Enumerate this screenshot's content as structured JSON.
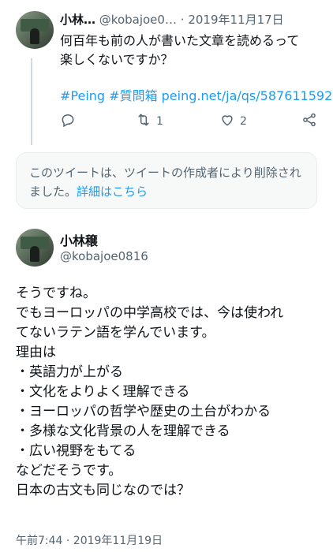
{
  "reply_tweet": {
    "display_name": "小林…",
    "handle": "@kobajoe0…",
    "separator": "·",
    "date": "2019年11月17日",
    "text_lines": [
      "何百年も前の人が書いた文章を読めるって",
      "楽しくないですか？"
    ],
    "hashtags": "#Peing #質問箱 peing.net/ja/qs/587611592",
    "actions": {
      "reply_icon": "reply-icon",
      "retweet_icon": "retweet-icon",
      "retweet_count": "1",
      "like_icon": "heart-icon",
      "like_count": "2",
      "share_icon": "share-icon"
    }
  },
  "deleted_notice": {
    "text": "このツイートは、ツイートの作成者により削除されました。",
    "link": "詳細はこちら"
  },
  "main_tweet": {
    "display_name": "小林穣",
    "handle": "@kobajoe0816",
    "body_lines": [
      "そうですね。",
      "でもヨーロッパの中学高校では、今は使われ",
      "てないラテン語を学んでいます。",
      "理由は",
      "・英語力が上がる",
      "・文化をよりよく理解できる",
      "・ヨーロッパの哲学や歴史の土台がわかる",
      "・多様な文化背景の人を理解できる",
      "・広い視野をもてる",
      "などだそうです。",
      "日本の古文も同じなのでは？"
    ],
    "timestamp": "午前7:44 · 2019年11月19日"
  },
  "colors": {
    "link": "#1d9bf0",
    "muted": "#536471",
    "text": "#0f1419"
  }
}
